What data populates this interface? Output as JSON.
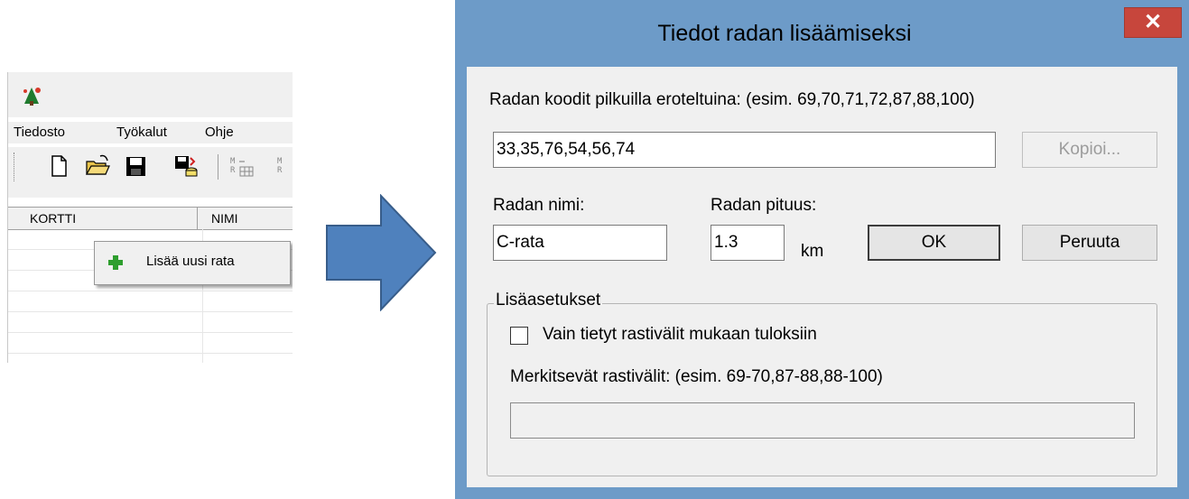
{
  "app": {
    "menu": {
      "file": "Tiedosto",
      "tools": "Työkalut",
      "help": "Ohje"
    },
    "columns": {
      "card": "KORTTI",
      "name": "NIMI"
    },
    "context_menu": {
      "add_course": "Lisää uusi rata"
    },
    "colors": {
      "add_icon": "#2e9e2e",
      "chrome": "#f0f0f0"
    }
  },
  "arrow": {
    "color": "#4f81bd",
    "border": "#385d8a"
  },
  "dialog": {
    "title": "Tiedot radan lisäämiseksi",
    "close_label": "✕",
    "codes_label": "Radan koodit pilkuilla eroteltuina: (esim. 69,70,71,72,87,88,100)",
    "codes_value": "33,35,76,54,56,74",
    "copy_button": "Kopioi...",
    "name_label": "Radan nimi:",
    "name_value": "C-rata",
    "length_label": "Radan pituus:",
    "length_value": "1.3",
    "length_unit": "km",
    "ok_button": "OK",
    "cancel_button": "Peruuta",
    "more_settings_label": "Lisäasetukset",
    "checkbox_label": "Vain tietyt rastivälit mukaan tuloksiin",
    "checkbox_checked": false,
    "legs_label": "Merkitsevät rastivälit: (esim. 69-70,87-88,88-100)",
    "legs_value": "",
    "colors": {
      "frame": "#6d9bc8",
      "close": "#c7463c",
      "client": "#f0f0f0"
    }
  }
}
